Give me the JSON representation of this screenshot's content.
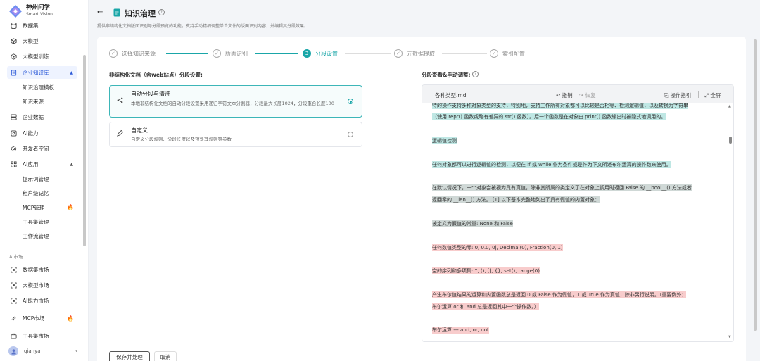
{
  "app": {
    "name": "神州问学",
    "subtitle": "Smart Vision"
  },
  "sidebar": {
    "items": [
      {
        "label": "数据集",
        "icon": "database-icon"
      },
      {
        "label": "大模型",
        "icon": "cube-icon"
      },
      {
        "label": "大模型训练",
        "icon": "training-icon"
      },
      {
        "label": "企业知识库",
        "icon": "book-icon",
        "expanded": true
      },
      {
        "label": "企业数据",
        "icon": "server-icon"
      },
      {
        "label": "AI能力",
        "icon": "ai-icon"
      },
      {
        "label": "开发者空间",
        "icon": "gear-icon"
      },
      {
        "label": "AI应用",
        "icon": "apps-icon",
        "expanded": true
      }
    ],
    "kb_children": [
      "知识治理模板",
      "知识来源"
    ],
    "ai_app_children": [
      "提示词管理",
      "租户级记忆",
      "MCP管理",
      "工具集管理",
      "工作流管理"
    ],
    "market_label": "AI市场",
    "market_items": [
      "数据集市场",
      "大模型市场",
      "AI能力市场",
      "MCP市场",
      "工具集市场"
    ],
    "user": "qianya"
  },
  "header": {
    "title": "知识治理",
    "description": "提供非结构化文档版面识别与分段预览的功能，支持手动精细调整单个文件的版面识别内容，并编辑其分段效果。"
  },
  "steps": [
    {
      "num": "1",
      "label": "选择知识来源",
      "state": "done"
    },
    {
      "num": "2",
      "label": "版面识别",
      "state": "done"
    },
    {
      "num": "3",
      "label": "分段设置",
      "state": "active"
    },
    {
      "num": "4",
      "label": "元数据提取",
      "state": "todo"
    },
    {
      "num": "5",
      "label": "索引配置",
      "state": "todo"
    }
  ],
  "left": {
    "title": "非结构化文档（含web站点）分段设置:",
    "options": [
      {
        "name": "自动分段与清洗",
        "desc": "本地非结构化文档的自动分段设置采用递归字符文本分割器，分段最大长度1024，分段重合长度100",
        "selected": true
      },
      {
        "name": "自定义",
        "desc": "自定义分段规则、分段长度以及预处理规则等参数",
        "selected": false
      }
    ]
  },
  "right": {
    "title": "分段查看&手动调整:",
    "file_name": "各种类型.md",
    "toolbar": {
      "undo": "撤销",
      "redo": "恢复",
      "guide": "操作指引",
      "fullscreen": "全屏"
    },
    "lines": [
      {
        "text": "特的操作支持多种对象类型的支持，特别地，支持工作所有对象都可以比较是否相等、检测逻辑值，以及转换为字符串",
        "hl": "teal"
      },
      {
        "text": "（使用 repr() 函数或略有差异的 str() 函数）。后一个函数是在对象由 print() 函数输出时被隐式地调用的。",
        "hl": "teal"
      },
      {
        "text": "逻辑值检测",
        "hl": "teal"
      },
      {
        "text": "任何对象都可以进行逻辑值的检测，以便在 if 或 while 作为条件或是作为下文所述布尔运算的操作数来使用。",
        "hl": "teal"
      },
      {
        "text": "在默认情况下，一个对象会被视为具有真值，除非其所属的类定义了在对象上调用时返回 False 的 __bool__() 方法或者",
        "hl": "gray"
      },
      {
        "text": "返回零的 __len__() 方法。 [1] 以下基本完整地列出了具有假值的内置对象：",
        "hl": "gray"
      },
      {
        "text": "被定义为假值的常量: None 和 False",
        "hl": "gray"
      },
      {
        "text": "任何数值类型的零: 0, 0.0, 0j, Decimal(0), Fraction(0, 1)",
        "hl": "pink"
      },
      {
        "text": "空的序列和多项集: '', (), [], {}, set(), range(0)",
        "hl": "pink"
      },
      {
        "text": "产生布尔值结果的运算和内置函数总是返回 0 或 False 作为假值，1 或 True 作为真值，除非另行说明。（重要例外：",
        "hl": "pink"
      },
      {
        "text": "布尔运算 or 和 and 总是返回其中一个操作数。）",
        "hl": "pink"
      },
      {
        "text": "布尔运算 --- and, or, not",
        "hl": "pink"
      }
    ]
  },
  "buttons": {
    "save": "保存并处理",
    "cancel": "取消"
  },
  "colors": {
    "accent": "#1aa6a8",
    "active_nav": "#2d5bd8"
  }
}
